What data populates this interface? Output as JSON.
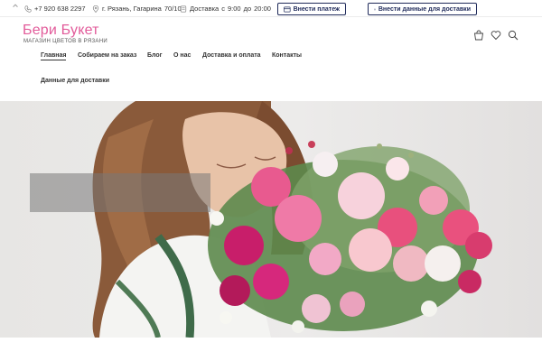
{
  "topbar": {
    "phone": "+7 920 638 2297",
    "address_prefix": "г. Рязань, Гагарина",
    "address_number": "70/10",
    "delivery_label": "Доставка",
    "delivery_from_word": "с",
    "delivery_from": "9:00",
    "delivery_to_word": "до",
    "delivery_to": "20:00",
    "pay_button": "Внести платеж",
    "delivery_data_button": "Внести данные для доставки"
  },
  "header": {
    "logo_title": "Бери Букет",
    "logo_subtitle": "МАГАЗИН ЦВЕТОВ В РЯЗАНИ"
  },
  "nav": {
    "items": [
      {
        "label": "Главная",
        "active": true
      },
      {
        "label": "Собираем на заказ"
      },
      {
        "label": "Блог"
      },
      {
        "label": "О нас"
      },
      {
        "label": "Доставка и оплата"
      },
      {
        "label": "Контакты"
      },
      {
        "label": "Данные для доставки"
      }
    ]
  },
  "icons": {
    "cart": "shopping-bag-icon",
    "wishlist": "heart-icon",
    "search": "search-icon"
  },
  "colors": {
    "brand": "#e25b9a",
    "button_border": "#1f2a5a"
  }
}
